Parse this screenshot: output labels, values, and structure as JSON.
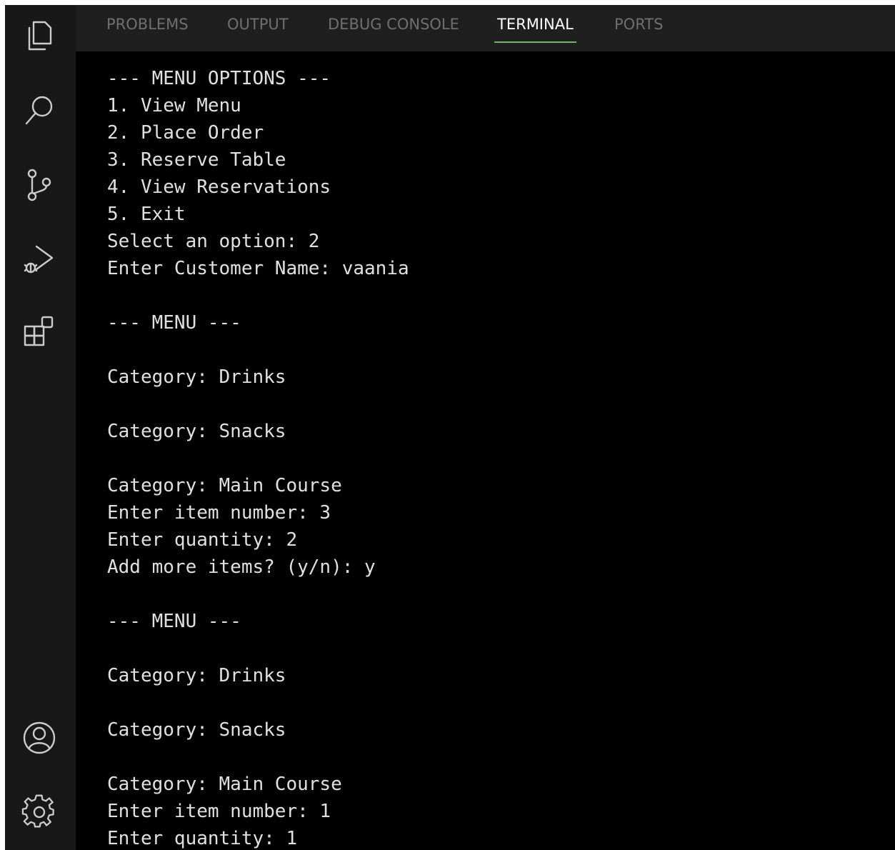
{
  "colors": {
    "accent": "#74b46a",
    "terminal_bg": "#000000",
    "activity_bar_bg": "#181818",
    "tab_bar_bg": "#1f1f1f",
    "text": "#e0e0e0"
  },
  "activity_bar": {
    "icons": [
      "explorer-icon",
      "search-icon",
      "source-control-icon",
      "run-debug-icon",
      "extensions-icon",
      "account-icon",
      "settings-gear-icon"
    ]
  },
  "panel": {
    "tabs": [
      "PROBLEMS",
      "OUTPUT",
      "DEBUG CONSOLE",
      "TERMINAL",
      "PORTS"
    ],
    "active_tab": "TERMINAL"
  },
  "terminal": {
    "lines": [
      "--- MENU OPTIONS ---",
      "1. View Menu",
      "2. Place Order",
      "3. Reserve Table",
      "4. View Reservations",
      "5. Exit",
      "Select an option: 2",
      "Enter Customer Name: vaania",
      "",
      "--- MENU ---",
      "",
      "Category: Drinks",
      "",
      "Category: Snacks",
      "",
      "Category: Main Course",
      "Enter item number: 3",
      "Enter quantity: 2",
      "Add more items? (y/n): y",
      "",
      "--- MENU ---",
      "",
      "Category: Drinks",
      "",
      "Category: Snacks",
      "",
      "Category: Main Course",
      "Enter item number: 1",
      "Enter quantity: 1"
    ]
  }
}
